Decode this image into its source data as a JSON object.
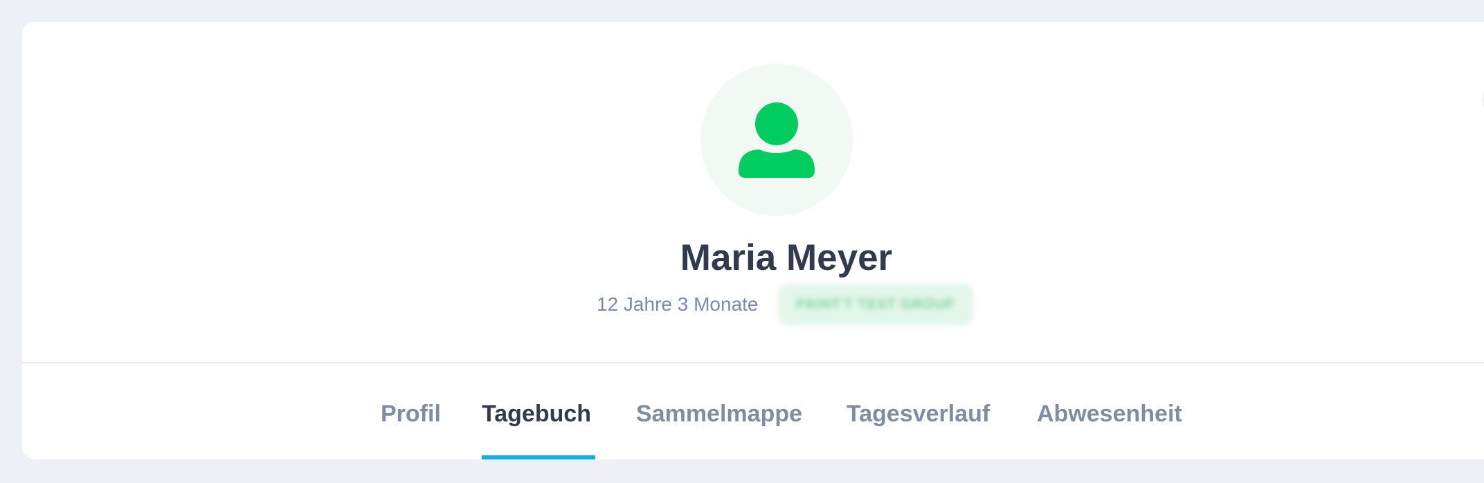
{
  "profile": {
    "name": "Maria Meyer",
    "age": "12 Jahre 3 Monate",
    "group_badge": "PAINT'T TEST GROUP"
  },
  "tabs": [
    {
      "label": "Profil",
      "active": false
    },
    {
      "label": "Tagebuch",
      "active": true
    },
    {
      "label": "Sammelmappe",
      "active": false
    },
    {
      "label": "Tagesverlauf",
      "active": false
    },
    {
      "label": "Abwesenheit",
      "active": false
    }
  ],
  "icons": {
    "avatar": "user-icon",
    "corner": "more-options-icon"
  },
  "colors": {
    "page_bg": "#edf0f4",
    "card_bg": "#ffffff",
    "avatar_bg": "#f2f8f4",
    "avatar_icon": "#00cc5f",
    "title": "#323b4e",
    "muted": "#7b8ba3",
    "tab_active_underline": "#10aee8"
  }
}
